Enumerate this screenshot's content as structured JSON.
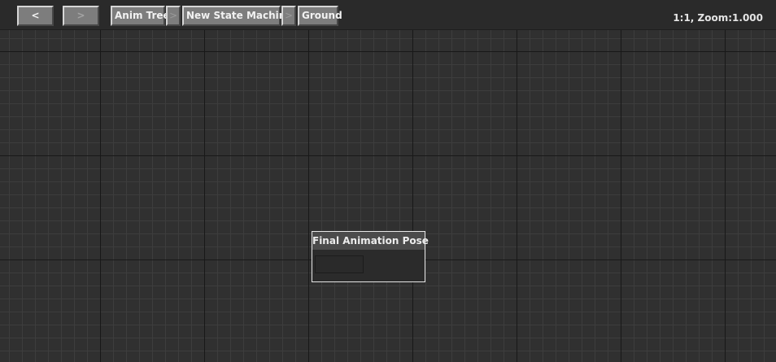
{
  "toolbar": {
    "back_label": "<",
    "forward_label": ">",
    "breadcrumbs": [
      {
        "label": "Anim Tree"
      },
      {
        "label": "New State Machine"
      },
      {
        "label": "Ground"
      }
    ],
    "separator": ">",
    "zoom_readout": "1:1, Zoom:1.000"
  },
  "node": {
    "title": "Final Animation Pose"
  }
}
